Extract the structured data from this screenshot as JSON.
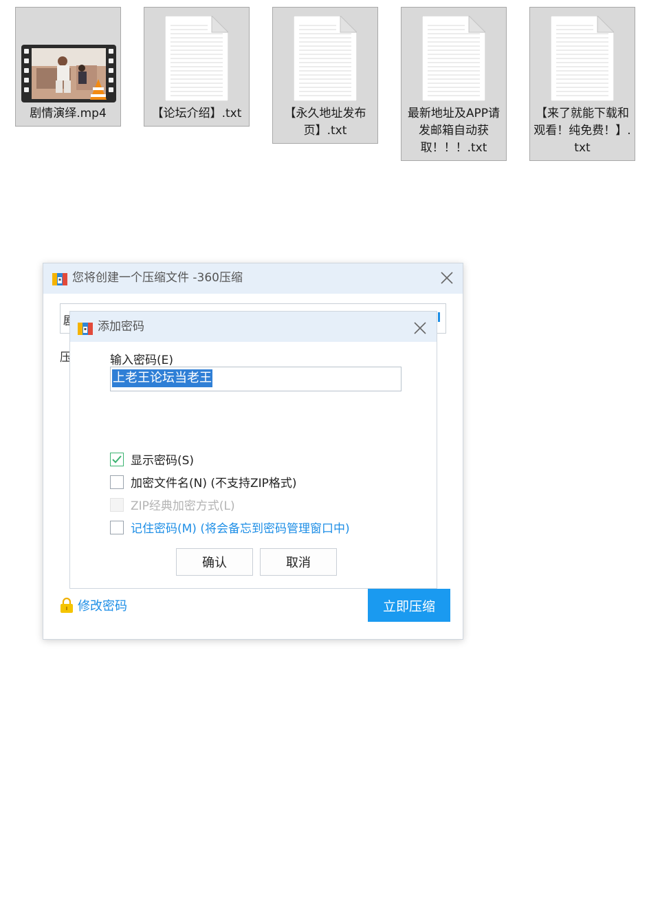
{
  "files": [
    {
      "name": "剧情演绎.mp4",
      "icon": "video-file-icon"
    },
    {
      "name": "【论坛介绍】.txt",
      "icon": "text-file-icon"
    },
    {
      "name": "【永久地址发布页】.txt",
      "icon": "text-file-icon"
    },
    {
      "name": "最新地址及APP请发邮箱自动获取！！！.txt",
      "icon": "text-file-icon"
    },
    {
      "name": "【来了就能下载和观看！纯免费！】.txt",
      "icon": "text-file-icon"
    }
  ],
  "main_dialog": {
    "title": "您将创建一个压缩文件 -360压缩",
    "field_char": "剧",
    "label_char": "压",
    "change_password_link": "修改密码",
    "compress_button": "立即压缩"
  },
  "password_dialog": {
    "title": "添加密码",
    "input_label": "输入密码(E)",
    "input_value": "上老王论坛当老王",
    "options": [
      {
        "label": "显示密码(S)",
        "checked": true,
        "state": "normal"
      },
      {
        "label": "加密文件名(N) (不支持ZIP格式)",
        "checked": false,
        "state": "normal"
      },
      {
        "label": "ZIP经典加密方式(L)",
        "checked": false,
        "state": "disabled"
      },
      {
        "label": "记住密码(M) (将会备忘到密码管理窗口中)",
        "checked": false,
        "state": "link"
      }
    ],
    "confirm_button": "确认",
    "cancel_button": "取消"
  },
  "colors": {
    "accent": "#1a9af0",
    "titlebar": "#e6eff9",
    "selection": "#2f7fd6",
    "check": "#3cb371"
  }
}
